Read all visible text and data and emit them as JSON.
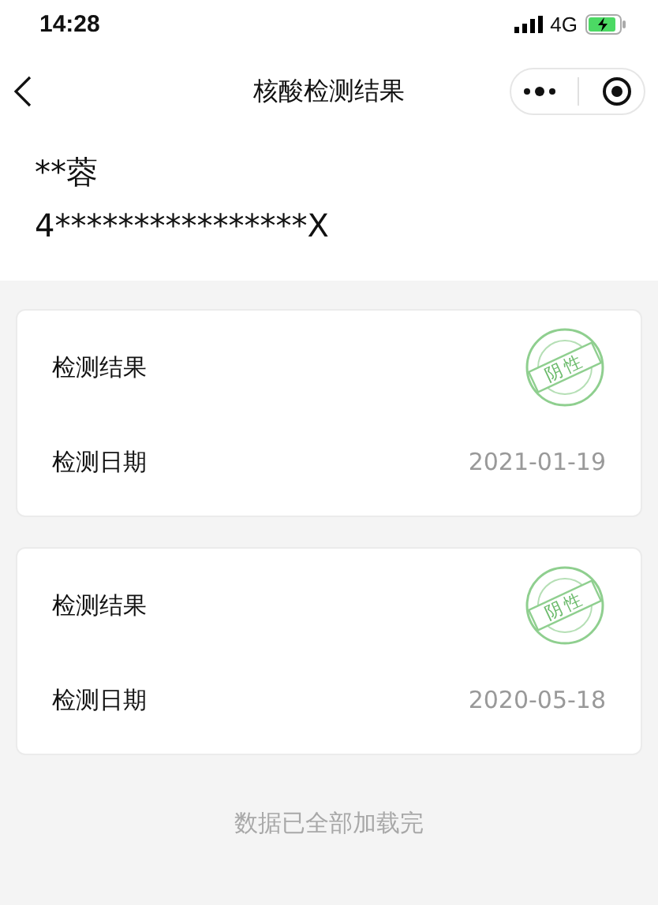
{
  "status_bar": {
    "time": "14:28",
    "network": "4G"
  },
  "nav": {
    "title": "核酸检测结果"
  },
  "person": {
    "name": "**蓉",
    "id_number": "4****************X"
  },
  "records": [
    {
      "result_label": "检测结果",
      "stamp": "阴性",
      "date_label": "检测日期",
      "date": "2021-01-19"
    },
    {
      "result_label": "检测结果",
      "stamp": "阴性",
      "date_label": "检测日期",
      "date": "2020-05-18"
    }
  ],
  "footer": "数据已全部加载完"
}
